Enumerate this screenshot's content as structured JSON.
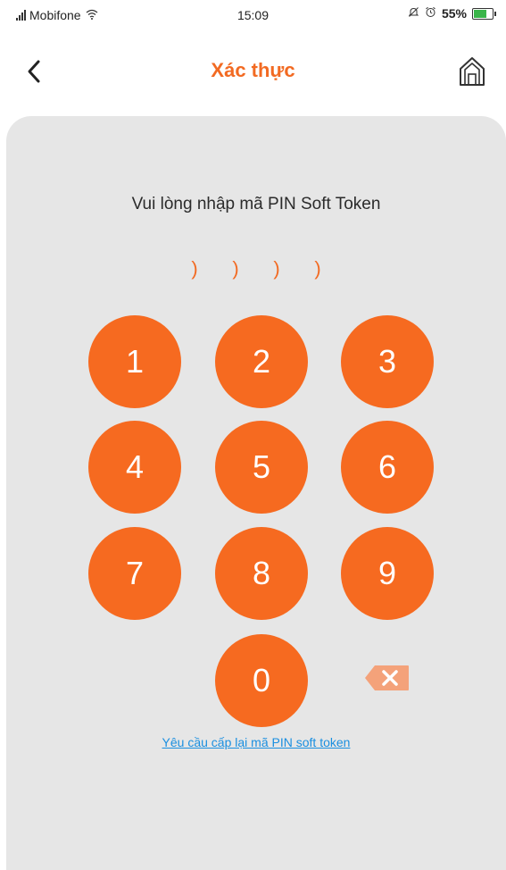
{
  "status_bar": {
    "carrier": "Mobifone",
    "time": "15:09",
    "battery": "55%"
  },
  "header": {
    "title": "Xác thực",
    "back_icon": "chevron-left-icon",
    "home_icon": "home-icon"
  },
  "prompt": "Vui lòng nhập mã PIN Soft Token",
  "pin": {
    "length": 4,
    "placeholder_glyph": ")"
  },
  "keypad": {
    "keys": [
      "1",
      "2",
      "3",
      "4",
      "5",
      "6",
      "7",
      "8",
      "9",
      "0"
    ],
    "delete_icon": "backspace-icon"
  },
  "reset_link": "Yêu cầu cấp lại mã PIN soft token",
  "colors": {
    "accent": "#f26a22",
    "key_bg": "#f66a20",
    "panel_bg": "#e6e6e6",
    "link": "#1a8fe0",
    "delete_bg": "#f4a27a"
  }
}
